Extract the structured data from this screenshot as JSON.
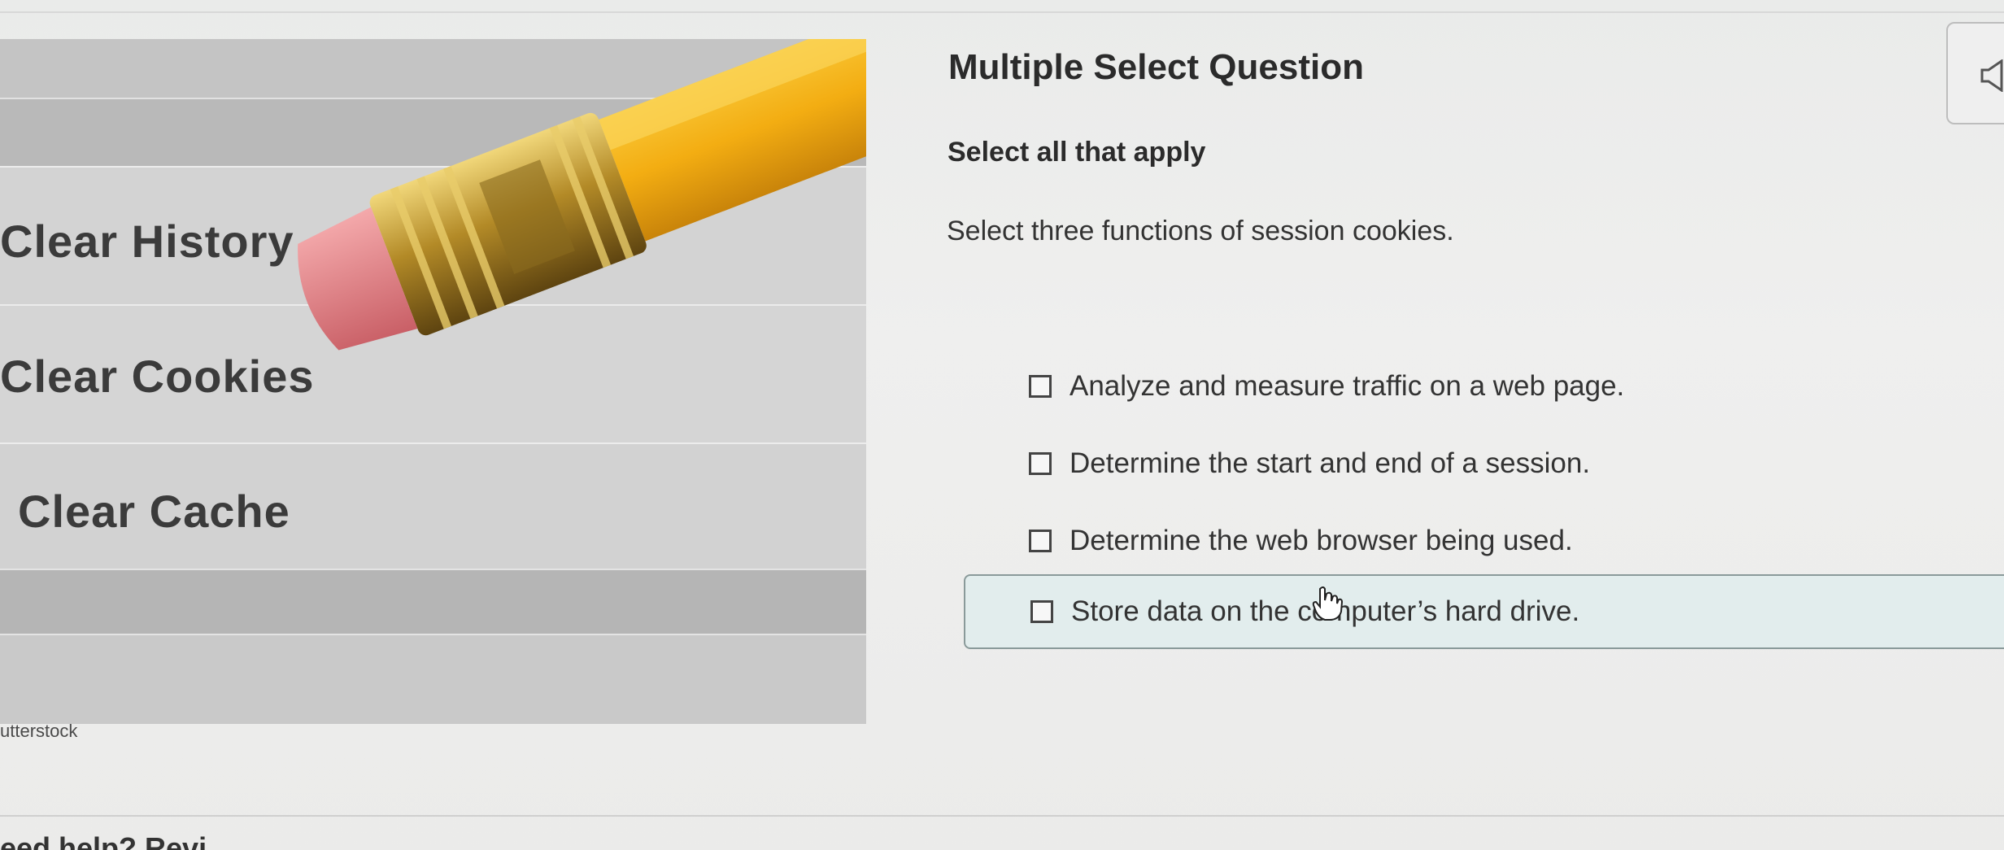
{
  "illustration": {
    "labels": [
      "Clear History",
      "Clear Cookies",
      "Clear Cache"
    ],
    "credit": "utterstock"
  },
  "question": {
    "title": "Multiple Select Question",
    "instruction": "Select all that apply",
    "prompt": "Select three functions of session cookies.",
    "options": [
      {
        "label": "Analyze and measure traffic on a web page.",
        "checked": false
      },
      {
        "label": "Determine the start and end of a session.",
        "checked": false
      },
      {
        "label": "Determine the web browser being used.",
        "checked": false
      },
      {
        "label": "Store data on the computer’s hard drive.",
        "checked": false,
        "hovered": true
      }
    ]
  },
  "audio": {
    "icon": "speaker-icon"
  },
  "footer": {
    "partial_text": "eed help? Revi"
  },
  "colors": {
    "highlight_bg": "#e2eded",
    "pencil_yellow": "#f4b21a",
    "eraser_pink": "#e7868a"
  }
}
